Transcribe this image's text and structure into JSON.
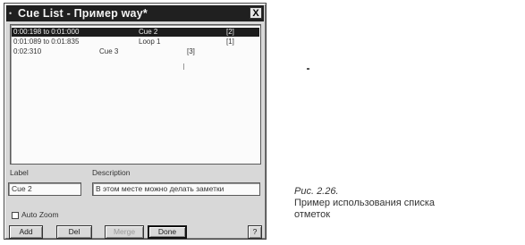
{
  "window": {
    "title": "Cue List - Пример way*",
    "close_label": "X",
    "system_icon": "dot-menu-icon"
  },
  "cue_list": {
    "rows": [
      {
        "time": "0:00:198 to 0:01:000",
        "name": "Cue 2",
        "flag": "[2]",
        "selected": true
      },
      {
        "time": "0:01:089 to 0:01:835",
        "name": "Loop 1",
        "flag": "[1]",
        "selected": false
      },
      {
        "time": "0:02:310",
        "name": "Cue 3",
        "flag": "[3]",
        "selected": false
      }
    ]
  },
  "form": {
    "label_caption": "Label",
    "description_caption": "Description",
    "label_value": "Cue 2",
    "description_value": "В этом месте можно делать заметки"
  },
  "options": {
    "auto_zoom_label": "Auto Zoom",
    "auto_zoom_checked": false
  },
  "buttons": {
    "add": "Add",
    "del": "Del",
    "merge": "Merge",
    "done": "Done",
    "help": "?"
  },
  "caption": {
    "figure": "Рис. 2.26.",
    "line1": "Пример использования списка",
    "line2": "отметок"
  }
}
